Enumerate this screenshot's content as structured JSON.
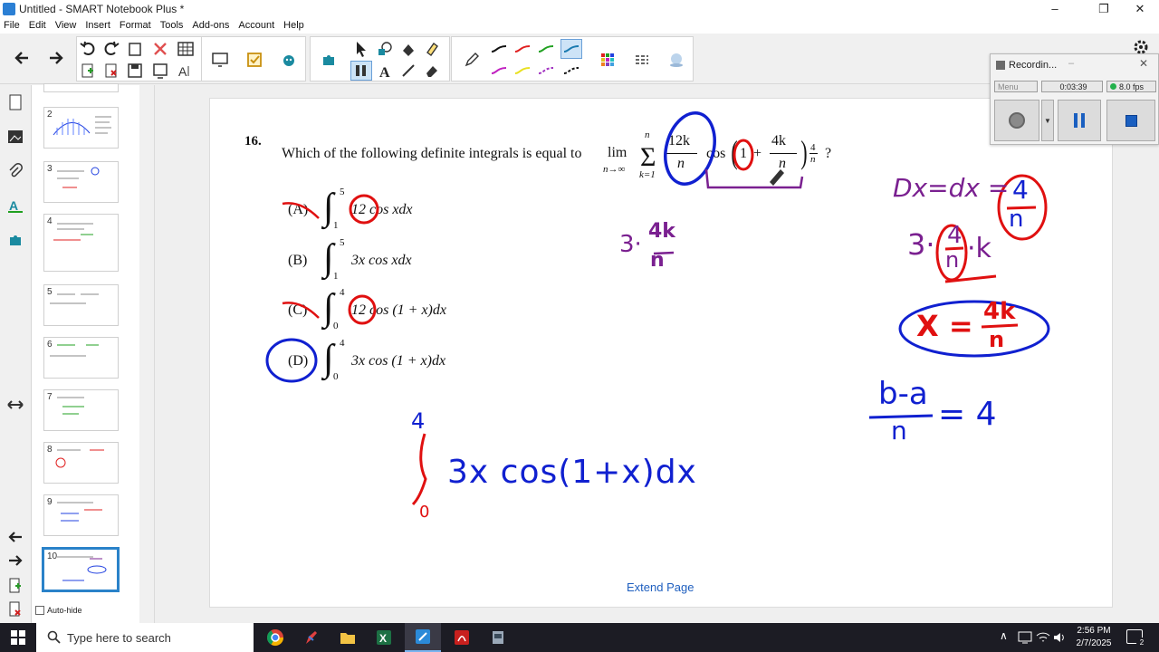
{
  "window": {
    "title": "Untitled - SMART Notebook Plus *",
    "minimize": "–",
    "maximize": "❐",
    "close": "✕"
  },
  "menu": [
    "File",
    "Edit",
    "View",
    "Insert",
    "Format",
    "Tools",
    "Add-ons",
    "Account",
    "Help"
  ],
  "sorter": {
    "thumb_numbers": [
      "2",
      "3",
      "4",
      "5",
      "6",
      "7",
      "8",
      "9",
      "10"
    ],
    "active_page": "10",
    "autohide_label": "Auto-hide"
  },
  "question": {
    "number": "16.",
    "prompt": "Which of the following definite integrals is equal to",
    "lim": "lim",
    "lim_sub": "n→∞",
    "sum_top": "n",
    "sum_bottom": "k=1",
    "term_num": "12k",
    "term_den": "n",
    "cos": "cos",
    "one": "1",
    "plus": "+",
    "frac_num": "4k",
    "frac_den": "n",
    "tail_num": "4",
    "tail_den": "n",
    "qmark": "?",
    "options": [
      {
        "label": "(A)",
        "upper": "5",
        "lower": "1",
        "integrand": "12 cos xdx"
      },
      {
        "label": "(B)",
        "upper": "5",
        "lower": "1",
        "integrand": "3x cos xdx"
      },
      {
        "label": "(C)",
        "upper": "4",
        "lower": "0",
        "integrand": "12 cos (1 + x)dx"
      },
      {
        "label": "(D)",
        "upper": "4",
        "lower": "0",
        "integrand": "3x cos (1 + x)dx"
      }
    ]
  },
  "handwriting": {
    "three_dot": "3·",
    "fourk_over_n_num": "4k",
    "fourk_over_n_den": "n",
    "answer_upper": "4",
    "answer_lower": "0",
    "answer_integrand": "3x cos(1+x)dx",
    "dx_eq": "Dx=dx =",
    "dx_num": "4",
    "dx_den": "n",
    "three_k_a": "3·",
    "three_k_num": "4",
    "three_k_den": "n",
    "three_k_b": "·k",
    "x_eq": "X =",
    "x_num": "4k",
    "x_den": "n",
    "ba_num": "b-a",
    "ba_den": "n",
    "ba_eq": "= 4"
  },
  "extend_page": "Extend Page",
  "recorder": {
    "title": "Recordin...",
    "menu": "Menu",
    "time": "0:03:39",
    "fps": "8.0 fps",
    "status_color": "#22b14c"
  },
  "taskbar": {
    "search_placeholder": "Type here to search",
    "time": "2:56 PM",
    "date": "2/7/2025",
    "notification_count": "2"
  },
  "colors": {
    "red_ink": "#e01010",
    "blue_ink": "#1020d0",
    "purple_ink": "#7a2090",
    "link_blue": "#1f5fbf",
    "accent": "#2a82c9"
  }
}
